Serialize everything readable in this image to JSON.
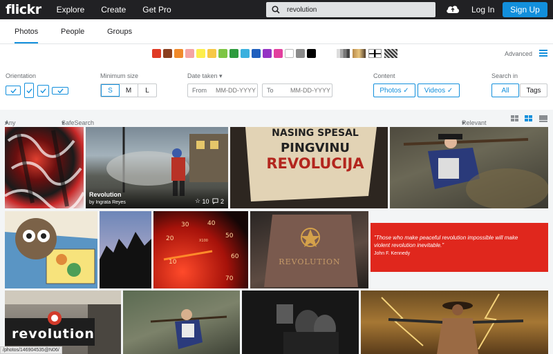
{
  "header": {
    "logo": "flickr",
    "nav": [
      "Explore",
      "Create",
      "Get Pro"
    ],
    "search_value": "revolution",
    "login": "Log In",
    "signup": "Sign Up"
  },
  "tabs": [
    "Photos",
    "People",
    "Groups"
  ],
  "color_swatches": [
    "#e03a24",
    "#8b3f1f",
    "#f0892a",
    "#f4a4a4",
    "#fdee4c",
    "#f7c846",
    "#7dc544",
    "#2e9b3e",
    "#3ab0de",
    "#1f5fbe",
    "#9433c4",
    "#e23f9e",
    "#ffffff",
    "#8a8a8a",
    "#000000"
  ],
  "advanced": "Advanced",
  "filters": {
    "orientation_label": "Orientation",
    "min_size_label": "Minimum size",
    "sizes": [
      "S",
      "M",
      "L"
    ],
    "date_taken_label": "Date taken",
    "from_label": "From",
    "to_label": "To",
    "date_placeholder": "MM-DD-YYYY",
    "content_label": "Content",
    "content_options": [
      "Photos",
      "Videos"
    ],
    "search_in_label": "Search in",
    "search_in_options": [
      "All",
      "Tags"
    ]
  },
  "subbar": {
    "license": "Any license",
    "safesearch": "SafeSearch on",
    "sort": "Relevant"
  },
  "photos": {
    "featured": {
      "title": "Revolution",
      "by": "by Ingrata Reyes",
      "faves": "10",
      "comments": "2"
    },
    "sign_text": [
      "NASING SPESAL",
      "PINGVINU",
      "REVOLUCIJA"
    ],
    "gauge_numbers": [
      "30",
      "40",
      "50",
      "60",
      "70",
      "20",
      "10",
      "X100"
    ],
    "book_title": "REVOLUTION",
    "quote": "\"Those who make peaceful revolution impossible will make violent revolution inevitable.\"",
    "quote_author": "John F. Kennedy",
    "storefront_text": "revolution"
  },
  "status_url": "/photos/146904535@N06/"
}
